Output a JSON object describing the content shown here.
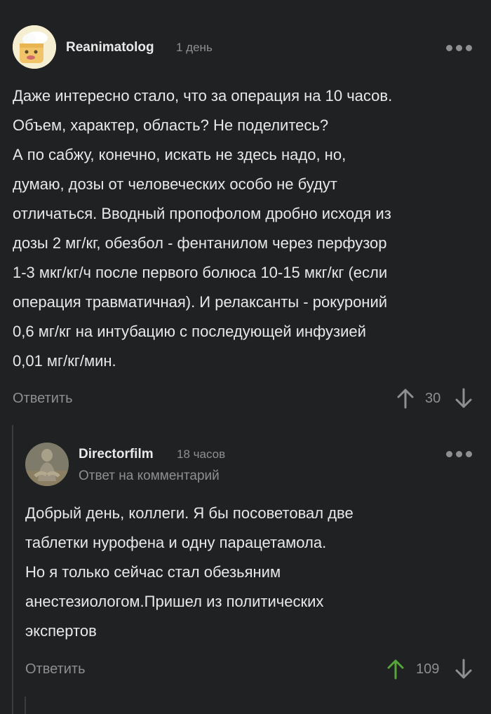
{
  "comments": [
    {
      "username": "Reanimatolog",
      "time": "1 день",
      "text": "Даже интересно стало, что за операция на 10 часов.\nОбъем, характер, область? Не поделитесь?\nА по сабжу, конечно, искать не здесь надо, но,\nдумаю, дозы от человеческих особо не будут\nотличаться. Вводный пропофолом дробно исходя из\nдозы 2 мг/кг, обезбол - фентанилом через перфузор\n1-3 мкг/кг/ч после первого болюса 10-15 мкг/кг (если\nоперация травматичная). И релаксанты - рокуроний\n0,6 мг/кг на интубацию с последующей инфузией\n0,01 мг/кг/мин.",
      "reply_label": "Ответить",
      "rating": "30",
      "upvoted": false
    },
    {
      "username": "Directorfilm",
      "time": "18 часов",
      "reply_to": "Ответ на комментарий",
      "text": "Добрый день, коллеги. Я бы посоветовал две\nтаблетки нурофена и одну парацетамола.\nНо я только сейчас стал обезьяним\nанестезиологом.Пришел из политических\nэкспертов",
      "reply_label": "Ответить",
      "rating": "109",
      "upvoted": true
    }
  ],
  "colors": {
    "background": "#1f2123",
    "muted": "#8d8f91",
    "upvote_active": "#57a53a"
  }
}
